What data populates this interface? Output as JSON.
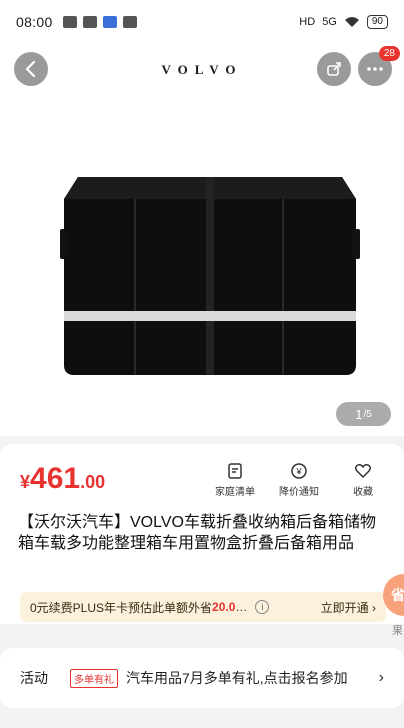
{
  "status_bar": {
    "time": "08:00",
    "network": "5G",
    "battery": "90"
  },
  "header": {
    "brand": "VOLVO",
    "more_badge": "28"
  },
  "gallery": {
    "current": "1",
    "total": "/5"
  },
  "price": {
    "symbol": "¥",
    "integer": "461",
    "decimal": ".00"
  },
  "actions": [
    {
      "label": "家庭清单",
      "icon": "list-icon"
    },
    {
      "label": "降价通知",
      "icon": "price-drop-icon"
    },
    {
      "label": "收藏",
      "icon": "heart-icon"
    }
  ],
  "product": {
    "title": "【沃尔沃汽车】VOLVO车载折叠收纳箱后备箱储物箱车载多功能整理箱车用置物盒折叠后备箱用品"
  },
  "plus_bar": {
    "text": "0元续费PLUS年卡预估此单额外省",
    "amount": "20.0",
    "ellipsis": "…",
    "action": "立即开通 ›"
  },
  "side_float": {
    "label": "省",
    "sub": "果"
  },
  "promo": {
    "label": "活动",
    "tag": "多单有礼",
    "text": "汽车用品7月多单有礼,点击报名参加",
    "chevron": "›"
  },
  "colors": {
    "accent": "#e8332e",
    "plus_bg": "#fbf1dc"
  }
}
